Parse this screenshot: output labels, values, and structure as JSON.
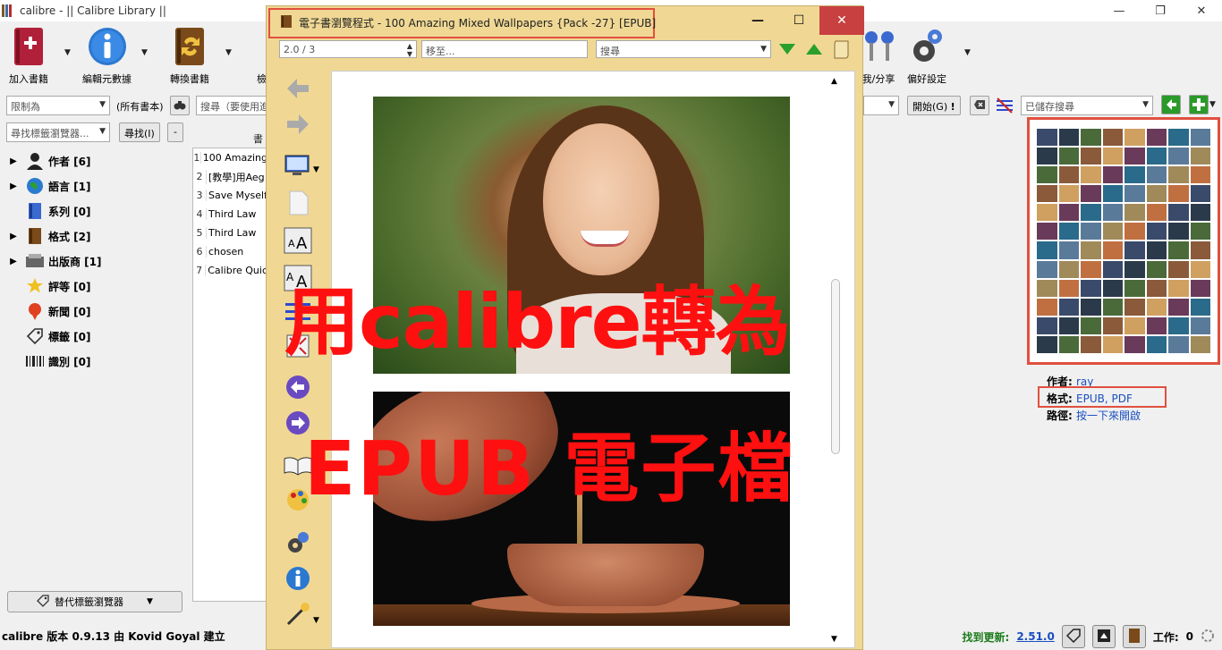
{
  "main_window": {
    "title": "calibre - || Calibre Library ||",
    "controls": {
      "minimize": "—",
      "restore": "❐",
      "close": "✕"
    }
  },
  "toolbar": {
    "add_books": "加入書籍",
    "edit_metadata": "編輯元數據",
    "convert_books": "轉換書籍",
    "partial_label": "檢",
    "share": "我/分享",
    "preferences": "偏好設定"
  },
  "search": {
    "restrict_placeholder": "限制為",
    "all_books": "(所有書本)",
    "search_placeholder": "搜尋（要使用進",
    "start_button": "開始(G)",
    "saved_search_placeholder": "已儲存搜尋",
    "find_tag_placeholder": "尋找標籤瀏覽器...",
    "find_button": "尋找(I)",
    "minus_button": "-"
  },
  "tag_browser": {
    "items": [
      {
        "label": "作者 [6]",
        "expandable": true,
        "icon": "person-icon"
      },
      {
        "label": "語言 [1]",
        "expandable": true,
        "icon": "globe-icon"
      },
      {
        "label": "系列 [0]",
        "expandable": false,
        "icon": "series-icon"
      },
      {
        "label": "格式 [2]",
        "expandable": true,
        "icon": "book-icon"
      },
      {
        "label": "出版商 [1]",
        "expandable": true,
        "icon": "publisher-icon"
      },
      {
        "label": "評等 [0]",
        "expandable": false,
        "icon": "star-icon"
      },
      {
        "label": "新聞 [0]",
        "expandable": false,
        "icon": "news-icon"
      },
      {
        "label": "標籤 [0]",
        "expandable": false,
        "icon": "tag-icon"
      },
      {
        "label": "識別 [0]",
        "expandable": false,
        "icon": "barcode-icon"
      }
    ],
    "alt_browser_button": "替代標籤瀏覽器"
  },
  "book_list": {
    "header": "書",
    "rows": [
      {
        "num": "1",
        "title": "100 Amazing"
      },
      {
        "num": "2",
        "title": "[教學]用Aeg"
      },
      {
        "num": "3",
        "title": "Save Myself"
      },
      {
        "num": "4",
        "title": "Third Law"
      },
      {
        "num": "5",
        "title": "Third Law"
      },
      {
        "num": "6",
        "title": "chosen"
      },
      {
        "num": "7",
        "title": "Calibre Quic"
      }
    ]
  },
  "book_details": {
    "author_label": "作者:",
    "author_value": "ray",
    "format_label": "格式:",
    "format_value": "EPUB, PDF",
    "path_label": "路徑:",
    "path_value": "按一下來開啟"
  },
  "status": {
    "version": "calibre 版本 0.9.13 由 Kovid Goyal 建立",
    "update_text": "找到更新:",
    "update_version": "2.51.0",
    "jobs": "工作:",
    "jobs_count": "0"
  },
  "viewer": {
    "title": "電子書瀏覽程式 - 100 Amazing Mixed Wallpapers {Pack -27} [EPUB]",
    "controls": {
      "minimize": "—",
      "maximize": "☐",
      "close": "✕"
    },
    "position": "2.0 / 3",
    "goto_placeholder": "移至...",
    "search_placeholder": "搜尋"
  },
  "overlay": {
    "line1": "用calibre轉為",
    "line2": "EPUB 電子檔"
  },
  "colors": {
    "highlight_border": "#e0503f",
    "viewer_bg": "#f0d894",
    "overlay_text": "#ff1010",
    "link": "#1a4fc0",
    "update_green": "#1a7a1a"
  }
}
